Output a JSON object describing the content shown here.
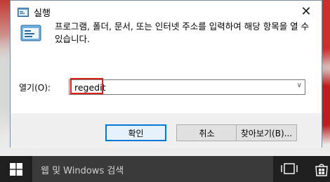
{
  "window": {
    "title": "실행",
    "close_glyph": "✕"
  },
  "dialog": {
    "description": "프로그램, 폴더, 문서, 또는 인터넷 주소를 입력하여 해당 항목을 열 수 있습니다.",
    "open_label": "열기(O):",
    "open_value": "regedit",
    "dropdown_glyph": "∨"
  },
  "buttons": {
    "ok": "확인",
    "cancel": "취소",
    "browse": "찾아보기(B)..."
  },
  "taskbar": {
    "search_placeholder": "웹 및 Windows 검색"
  },
  "colors": {
    "highlight_box": "#e0201b",
    "primary_button_border": "#0078d7",
    "taskbar_bg": "#1f1f1f",
    "search_bg": "#3a3a3a"
  },
  "icons": {
    "title": "run-app-icon",
    "dialog": "run-app-icon",
    "start": "windows-logo-icon",
    "task_view": "task-view-icon",
    "store": "store-icon"
  }
}
